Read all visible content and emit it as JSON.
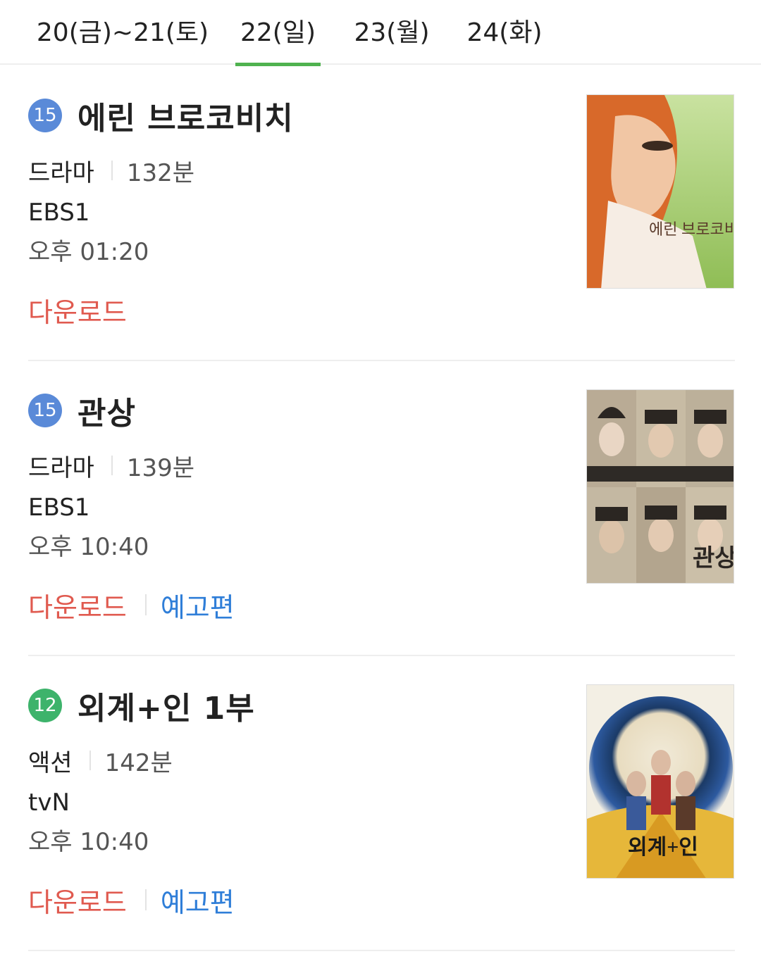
{
  "tabs": [
    {
      "label": "20(금)~21(토)"
    },
    {
      "label": "22(일)"
    },
    {
      "label": "23(월)"
    },
    {
      "label": "24(화)"
    }
  ],
  "active_tab": "22(일)",
  "colors": {
    "tab_active_underline": "#4fb24f",
    "rating_15": "#5a8ad8",
    "rating_12": "#3db36b",
    "download": "#e05a4f",
    "trailer": "#2f7ed8"
  },
  "movies": [
    {
      "rating": "15",
      "title": "에린 브로코비치",
      "genre": "드라마",
      "duration": "132분",
      "channel": "EBS1",
      "time": "오후 01:20",
      "download_label": "다운로드",
      "poster_text": "에린 브로코비치"
    },
    {
      "rating": "15",
      "title": "관상",
      "genre": "드라마",
      "duration": "139분",
      "channel": "EBS1",
      "time": "오후 10:40",
      "download_label": "다운로드",
      "trailer_label": "예고편",
      "poster_text": "관상"
    },
    {
      "rating": "12",
      "title": "외계+인 1부",
      "genre": "액션",
      "duration": "142분",
      "channel": "tvN",
      "time": "오후 10:40",
      "download_label": "다운로드",
      "trailer_label": "예고편",
      "poster_text": "외계+인"
    }
  ]
}
